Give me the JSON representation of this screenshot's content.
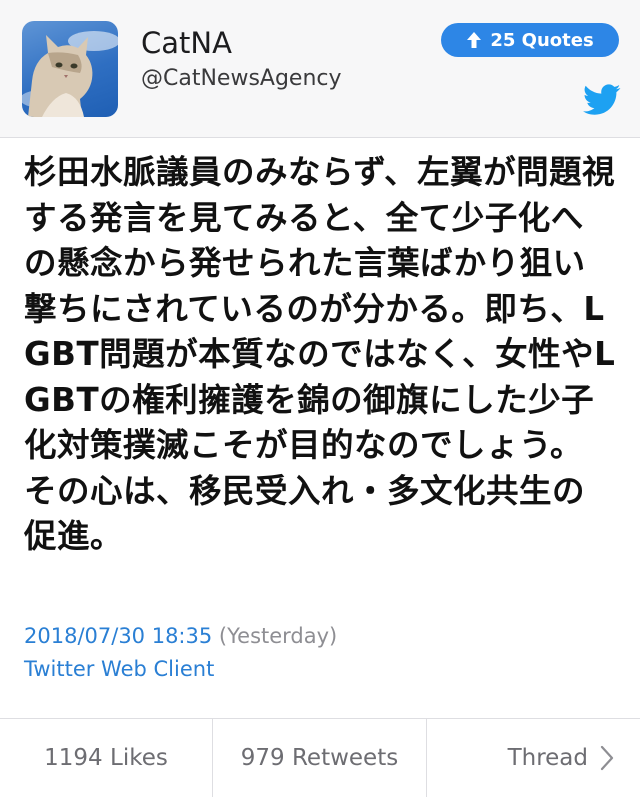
{
  "header": {
    "name": "CatNA",
    "handle": "@CatNewsAgency",
    "quotes_badge": "25 Quotes",
    "avatar_icon": "cat-avatar",
    "twitter_icon": "twitter-bird-icon",
    "accent_color": "#2d86e6",
    "twitter_color": "#1da1f2"
  },
  "tweet": {
    "text": "杉田水脈議員のみならず、左翼が問題視する発言を見てみると、全て少子化への懸念から発せられた言葉ばかり狙い撃ちにされているのが分かる。即ち、LGBT問題が本質なのではなく、女性やLGBTの権利擁護を錦の御旗にした少子化対策撲滅こそが目的なのでしょう。その心は、移民受入れ・多文化共生の促進。"
  },
  "meta": {
    "date": "2018/07/30 18:35",
    "relative": "(Yesterday)",
    "client": "Twitter Web Client",
    "link_color": "#2a7fd4"
  },
  "footer": {
    "likes": "1194 Likes",
    "retweets": "979 Retweets",
    "thread": "Thread"
  }
}
